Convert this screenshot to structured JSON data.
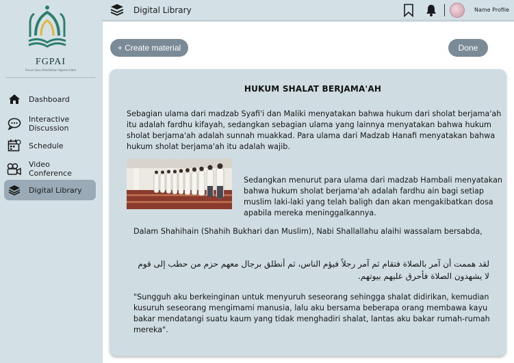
{
  "sidebar": {
    "brand": "FGPAI",
    "brand_sub": "Forum Guru Pendidikan Agama Islam",
    "items": [
      {
        "label": "Dashboard",
        "icon": "home-icon"
      },
      {
        "label": "Interactive Discussion",
        "icon": "chat-icon"
      },
      {
        "label": "Schedule",
        "icon": "calendar-icon"
      },
      {
        "label": "Video Conference",
        "icon": "video-icon"
      },
      {
        "label": "Digital Library",
        "icon": "book-icon",
        "active": true
      }
    ]
  },
  "topbar": {
    "title": "Digital Library",
    "profile_label": "Name Profile"
  },
  "toolbar": {
    "create_label": "+ Create material",
    "done_label": "Done"
  },
  "article": {
    "title": "HUKUM SHALAT BERJAMA'AH",
    "p1": "Sebagian ulama dari madzab Syafi'i dan Maliki menyatakan bahwa hukum dari sholat berjama'ah itu adalah fardhu kifayah, sedangkan sebagian ulama yang lainnya menyatakan bahwa hukum sholat berjama'ah adalah sunnah muakkad. Para ulama dari Madzab Hanafi menyatakan bahwa hukum sholat berjama'ah itu adalah wajib.",
    "p2": "Sedangkan menurut para ulama dari madzab Hambali menyatakan bahwa hukum sholat berjama'ah adalah fardhu ain bagi setiap muslim laki-laki yang telah baligh dan akan mengakibatkan dosa apabila mereka meninggalkannya.",
    "p3": "Dalam Shahihain (Shahih Bukhari dan Muslim), Nabi Shallallahu alaihi wassalam bersabda,",
    "arabic": "لقد هممت أن آمر بالصلاة فتقام ثم آمر رجلاً فيؤم الناس، ثم أنطلق برجال معهم حزم من حطب إلى قوم لا يشهدون الصلاة فأحرق عليهم بيوتهم.",
    "p4": "\"Sungguh aku berkeinginan untuk menyuruh seseorang sehingga shalat didirikan, kemudian kusuruh seseorang mengimami manusia, lalu aku bersama beberapa orang membawa kayu bakar mendatangi suatu kaum yang tidak menghadiri shalat, lantas aku bakar rumah-rumah mereka\"."
  },
  "colors": {
    "sidebar_bg": "#d3e1e7",
    "card_bg": "#cfdde3",
    "button_bg": "#7a8a96",
    "active_nav_bg": "#9aaab6",
    "logo_green": "#2f7d6c"
  }
}
